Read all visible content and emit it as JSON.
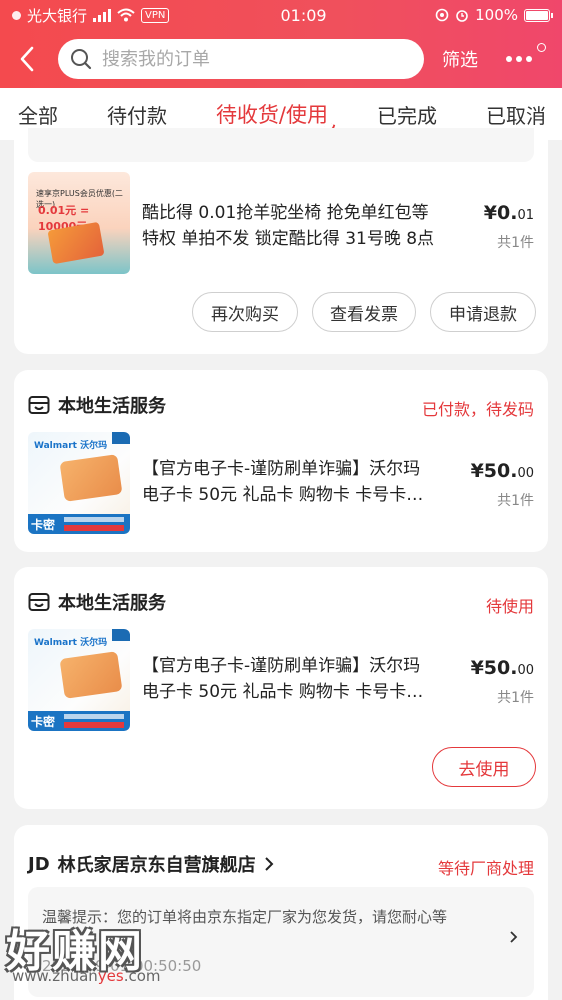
{
  "status_bar": {
    "carrier": "光大银行",
    "vpn": "VPN",
    "time": "01:09",
    "battery": "100%"
  },
  "header": {
    "search_placeholder": "搜索我的订单",
    "filter_label": "筛选"
  },
  "tabs": [
    "全部",
    "待付款",
    "待收货/使用",
    "已完成",
    "已取消"
  ],
  "active_tab": "待收货/使用",
  "orders": [
    {
      "thumb_text": [
        "速享京PLUS会员优惠(二选一)",
        "0.01元 = 10000元"
      ],
      "title_lines": [
        "酷比得 0.01抢羊驼坐椅 抢免单红包等",
        "特权 单拍不发 锁定酷比得 31号晚 8点"
      ],
      "price_int": "¥0.",
      "price_dec": "01",
      "count": "共1件",
      "buttons": [
        "再次购买",
        "查看发票",
        "申请退款"
      ]
    },
    {
      "shop": "本地生活服务",
      "status": "已付款，待发码",
      "thumb_brand": "Walmart 沃尔玛",
      "thumb_tag": "卡密",
      "title_lines": [
        "【官方电子卡-谨防刷单诈骗】沃尔玛",
        "电子卡 50元 礼品卡 购物卡 卡号卡…"
      ],
      "price_int": "¥50.",
      "price_dec": "00",
      "count": "共1件"
    },
    {
      "shop": "本地生活服务",
      "status": "待使用",
      "thumb_brand": "Walmart 沃尔玛",
      "thumb_tag": "卡密",
      "title_lines": [
        "【官方电子卡-谨防刷单诈骗】沃尔玛",
        "电子卡 50元 礼品卡 购物卡 卡号卡…"
      ],
      "price_int": "¥50.",
      "price_dec": "00",
      "count": "共1件",
      "buttons": [
        "去使用"
      ]
    },
    {
      "shop_prefix": "JD",
      "shop": "林氏家居京东自营旗舰店",
      "status": "等待厂商处理",
      "notice": "温馨提示：您的订单将由京东指定厂家为您发货，请您耐心等",
      "notice_time": "2021-09-01 00:50:50"
    }
  ],
  "watermark": {
    "text": "好赚网",
    "url_a": "www.zhuan",
    "url_b": "yes",
    "url_c": ".com"
  },
  "colors": {
    "brand_red": "#e4393c",
    "header_gradient": [
      "#f44a4e",
      "#f0476b"
    ]
  }
}
